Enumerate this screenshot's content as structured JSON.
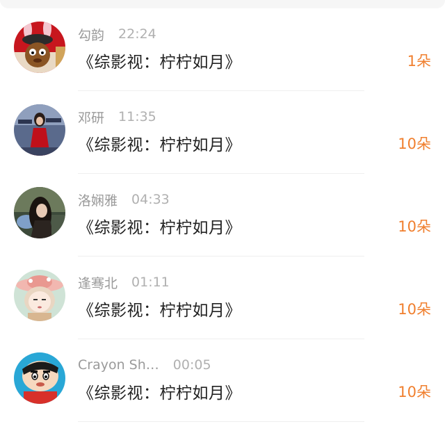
{
  "accent_color": "#f07f2e",
  "gifts": [
    {
      "user": "勾韵",
      "time": "22:24",
      "book": "《综影视：柠柠如月》",
      "count": "1朵",
      "avatar": "bunny-cartoon-avatar"
    },
    {
      "user": "邓研",
      "time": "11:35",
      "book": "《综影视：柠柠如月》",
      "count": "10朵",
      "avatar": "woman-red-dress-avatar"
    },
    {
      "user": "洛娴雅",
      "time": "04:33",
      "book": "《综影视：柠柠如月》",
      "count": "10朵",
      "avatar": "dark-hair-girl-avatar"
    },
    {
      "user": "逢骞北",
      "time": "01:11",
      "book": "《综影视：柠柠如月》",
      "count": "10朵",
      "avatar": "anime-hat-girl-avatar"
    },
    {
      "user": "Crayon Sh…",
      "time": "00:05",
      "book": "《综影视：柠柠如月》",
      "count": "10朵",
      "avatar": "crayon-shinchan-avatar"
    }
  ]
}
